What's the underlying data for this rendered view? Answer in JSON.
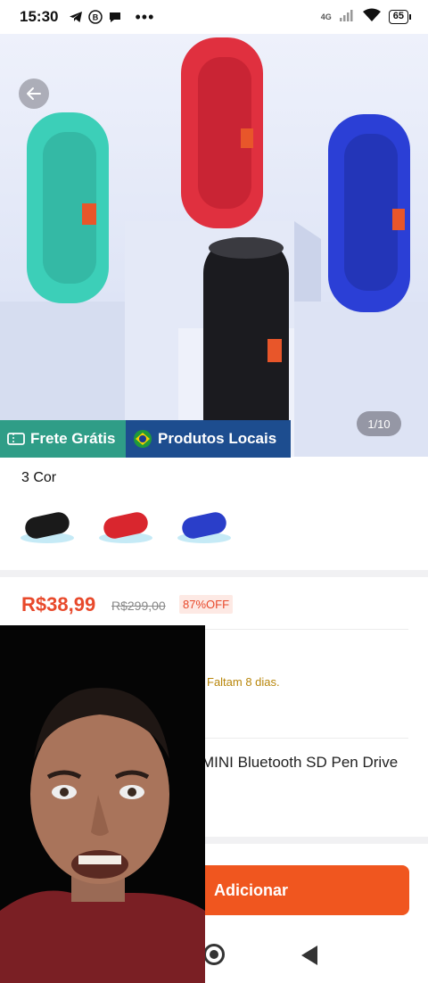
{
  "status_bar": {
    "time": "15:30",
    "battery": "65",
    "network": "4G",
    "icons": [
      "telegram-icon",
      "b-icon",
      "chat-icon",
      "more-icon",
      "signal-icon",
      "wifi-icon",
      "battery-icon"
    ]
  },
  "product_images": {
    "counter": "1/10",
    "speaker_colors": [
      "#3ccfb8",
      "#e0303f",
      "#2b3fd6",
      "#1b1b1f"
    ]
  },
  "badges": {
    "frete": "Frete Grátis",
    "locais": "Produtos Locais"
  },
  "colors": {
    "title": "3 Cor",
    "options": [
      {
        "color": "#1a1a1a"
      },
      {
        "color": "#d9262e"
      },
      {
        "color": "#2a3ec9"
      }
    ]
  },
  "price": {
    "current": "R$38,99",
    "original": "R$299,00",
    "discount": "87%OFF"
  },
  "promo": {
    "deadline": "Faltam 8 dias."
  },
  "product": {
    "title": "MINI Bluetooth SD Pen Drive"
  },
  "actions": {
    "add_label": "Adicionar"
  },
  "theme": {
    "accent": "#f0561f",
    "price": "#e8492b",
    "frete_bg": "#2f9d87",
    "locais_bg": "#1d4d8f"
  }
}
